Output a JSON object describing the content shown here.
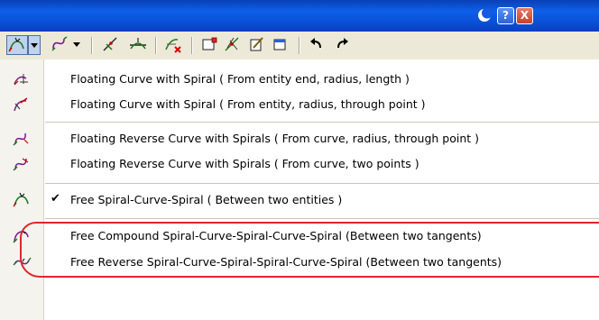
{
  "titlebar": {
    "help_glyph": "?",
    "close_glyph": "X",
    "help_icon": "help-icon",
    "close_icon": "close-icon",
    "app_icon": "crescent-moon-icon"
  },
  "toolbar": {
    "icons": [
      "spiral-curve-tool-icon",
      "dropdown-arrow-icon",
      "reverse-spiral-tool-icon",
      "dropdown-arrow-icon",
      "pin-line-tool-icon",
      "offset-line-tool-icon",
      "delete-curve-tool-icon",
      "label-red-icon",
      "edit-points-tool-icon",
      "properties-edit-icon",
      "table-icon",
      "undo-icon",
      "redo-icon"
    ]
  },
  "menu": {
    "items": [
      {
        "label": "Floating Curve with Spiral ( From entity end, radius, length )",
        "icon": "floating-curve-spiral-end-icon",
        "checked": false
      },
      {
        "label": "Floating Curve with Spiral ( From entity, radius, through point )",
        "icon": "floating-curve-spiral-point-icon",
        "checked": false
      },
      {
        "label": "Floating Reverse Curve with Spirals ( From curve, radius, through point )",
        "icon": "floating-reverse-curve-point-icon",
        "checked": false
      },
      {
        "label": "Floating Reverse Curve with Spirals ( From curve, two points )",
        "icon": "floating-reverse-curve-two-points-icon",
        "checked": false
      },
      {
        "label": "Free Spiral-Curve-Spiral ( Between two entities )",
        "icon": "free-spiral-curve-spiral-icon",
        "checked": true,
        "check_glyph": "✔"
      },
      {
        "label": "Free Compound Spiral-Curve-Spiral-Curve-Spiral (Between two tangents)",
        "icon": "free-compound-spiral-icon",
        "checked": false
      },
      {
        "label": "Free Reverse Spiral-Curve-Spiral-Spiral-Curve-Spiral (Between two tangents)",
        "icon": "free-reverse-spiral-icon",
        "checked": false
      }
    ]
  },
  "colors": {
    "titlebar": "#0a50d8",
    "toolbar_bg": "#ece9d8",
    "highlight_ring": "#e0262a",
    "active_tool_bg": "#c1d2ee"
  }
}
